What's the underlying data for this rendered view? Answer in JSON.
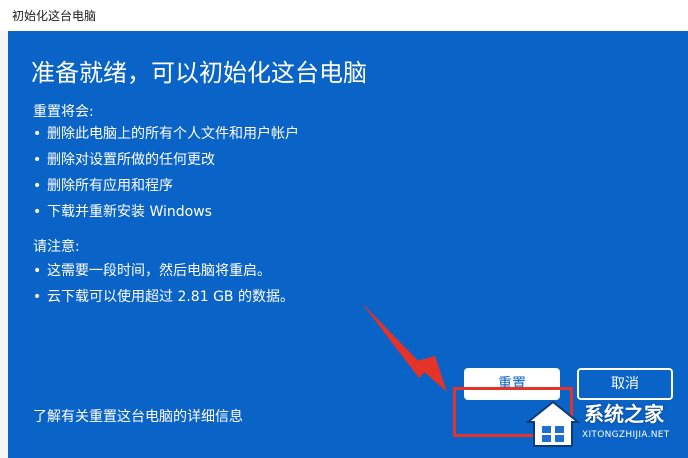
{
  "window": {
    "title": "初始化这台电脑"
  },
  "dialog": {
    "heading": "准备就绪，可以初始化这台电脑",
    "reset_section_label": "重置将会:",
    "reset_items": [
      "删除此电脑上的所有个人文件和用户帐户",
      "删除对设置所做的任何更改",
      "删除所有应用和程序",
      "下载并重新安装 Windows"
    ],
    "note_section_label": "请注意:",
    "note_items": [
      "这需要一段时间，然后电脑将重启。",
      "云下载可以使用超过 2.81 GB 的数据。"
    ],
    "learn_more_link": "了解有关重置这台电脑的详细信息",
    "reset_button": "重置",
    "cancel_button": "取消",
    "bullet_glyph": "•"
  },
  "watermark": {
    "site_name": "系统之家",
    "site_url": "XITONGZHIJIA.NET"
  },
  "colors": {
    "panel_blue": "#0a63c6",
    "annotation_red": "#e6332a"
  }
}
